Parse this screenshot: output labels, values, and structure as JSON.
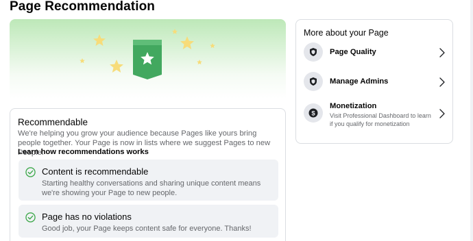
{
  "page": {
    "title": "Page Recommendation"
  },
  "recommendation": {
    "title": "Recommendable",
    "description": "We're helping you grow your audience because Pages like yours bring people together. Your Page is now in lists where we suggest Pages to new People.",
    "link_label": "Learn how recommendations works",
    "statuses": [
      {
        "title": "Content is recommendable",
        "description": "Starting healthy conversations and sharing unique content means we're showing your Page to new people.",
        "icon": "check-circle-icon"
      },
      {
        "title": "Page has no violations",
        "description": "Good job, your Page keeps content safe for everyone. Thanks!",
        "icon": "check-circle-icon"
      }
    ]
  },
  "sidebar": {
    "title": "More about your Page",
    "items": [
      {
        "label": "Page Quality",
        "subtitle": "",
        "icon": "shield-icon"
      },
      {
        "label": "Manage Admins",
        "subtitle": "",
        "icon": "shield-icon"
      },
      {
        "label": "Monetization",
        "subtitle": "Visit Professional Dashboard to learn if you qualify for monetization",
        "icon": "dollar-icon"
      }
    ]
  },
  "colors": {
    "accent_green": "#3da84a",
    "badge_green": "#42a85f",
    "star_yellow": "#f7dc7a",
    "text_primary": "#050505",
    "text_secondary": "#65676b",
    "panel_bg": "#f0f2f5"
  }
}
